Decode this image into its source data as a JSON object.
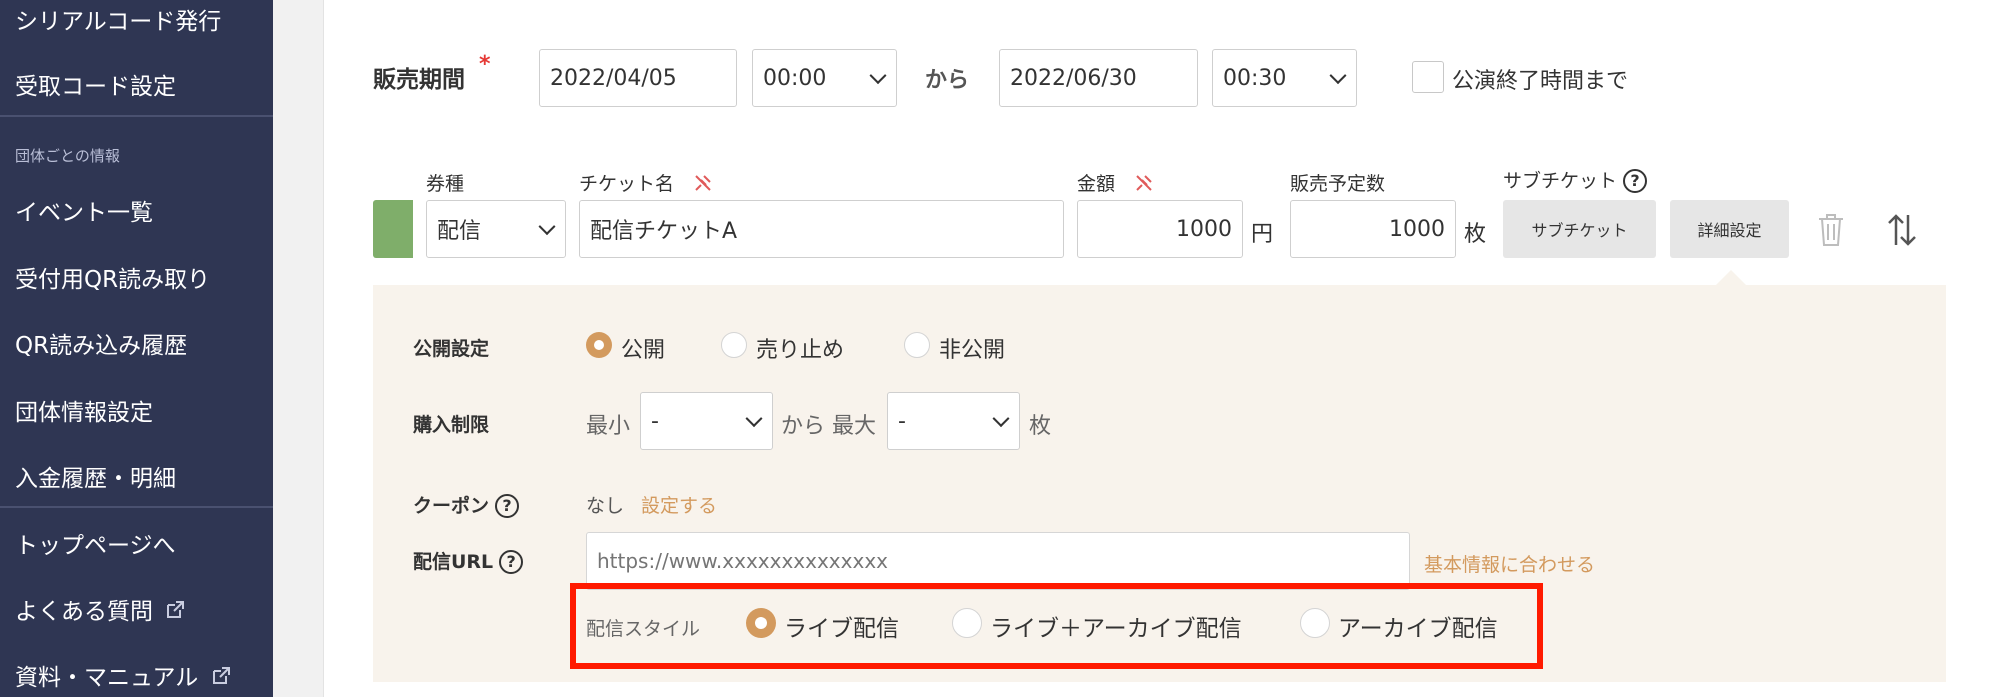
{
  "sidebar": {
    "items": [
      {
        "label": "シリアルコード発行"
      },
      {
        "label": "受取コード設定"
      },
      {
        "label": "イベント一覧"
      },
      {
        "label": "受付用QR読み取り"
      },
      {
        "label": "QR読み込み履歴"
      },
      {
        "label": "団体情報設定"
      },
      {
        "label": "入金履歴・明細"
      },
      {
        "label": "トップページへ"
      },
      {
        "label": "よくある質問"
      },
      {
        "label": "資料・マニュアル"
      }
    ],
    "section_label": "団体ごとの情報"
  },
  "sales_period": {
    "label": "販売期間",
    "required_mark": "*",
    "start_date": "2022/04/05",
    "start_time": "00:00",
    "separator": "から",
    "end_date": "2022/06/30",
    "end_time": "00:30",
    "until_end_label": "公演終了時間まで"
  },
  "ticket_row": {
    "headers": {
      "type": "券種",
      "name": "チケット名",
      "price": "金額",
      "quantity": "販売予定数",
      "subticket": "サブチケット"
    },
    "type_value": "配信",
    "name_value": "配信チケットA",
    "price_value": "1000",
    "price_unit": "円",
    "quantity_value": "1000",
    "quantity_unit": "枚",
    "subticket_button": "サブチケット",
    "detail_button": "詳細設定",
    "accent_color": "#7fae6a"
  },
  "details": {
    "visibility": {
      "label": "公開設定",
      "options": [
        "公開",
        "売り止め",
        "非公開"
      ],
      "selected": "公開"
    },
    "purchase_limit": {
      "label": "購入制限",
      "min_label": "最小",
      "min_value": "-",
      "range_sep": "から 最大",
      "max_value": "-",
      "unit": "枚"
    },
    "coupon": {
      "label": "クーポン",
      "value": "なし",
      "action": "設定する"
    },
    "stream_url": {
      "label": "配信URL",
      "placeholder": "https://www.xxxxxxxxxxxxxx",
      "action": "基本情報に合わせる"
    },
    "stream_style": {
      "label": "配信スタイル",
      "options": [
        "ライブ配信",
        "ライブ＋アーカイブ配信",
        "アーカイブ配信"
      ],
      "selected": "ライブ配信"
    },
    "accent_color": "#d39a5e",
    "highlight_color": "#ff1a00"
  }
}
